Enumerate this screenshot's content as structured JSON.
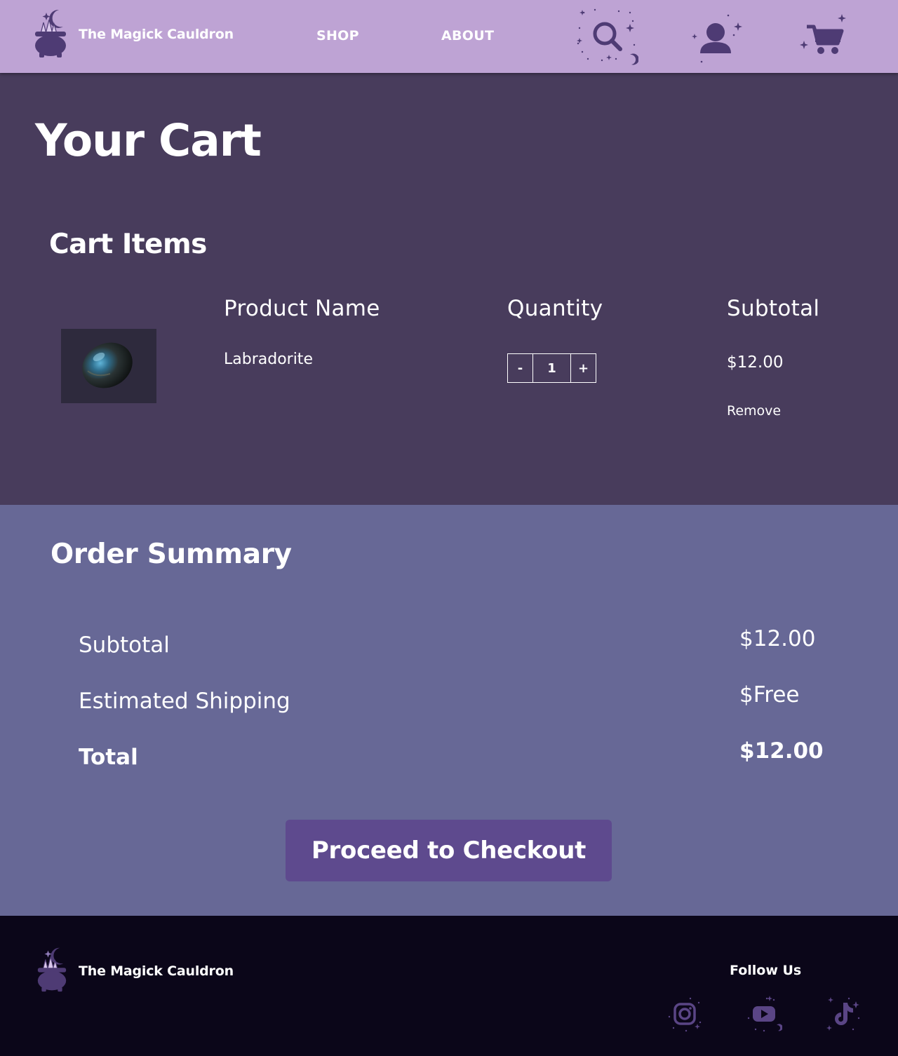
{
  "header": {
    "brand": "The Magick Cauldron",
    "nav": [
      {
        "label": "SHOP"
      },
      {
        "label": "ABOUT"
      }
    ],
    "icons": [
      "search-icon",
      "account-icon",
      "cart-icon"
    ]
  },
  "page": {
    "title": "Your Cart"
  },
  "cart": {
    "section_title": "Cart Items",
    "columns": {
      "product": "Product Name",
      "quantity": "Quantity",
      "subtotal": "Subtotal"
    },
    "items": [
      {
        "name": "Labradorite",
        "quantity": "1",
        "minus": "-",
        "plus": "+",
        "subtotal": "$12.00",
        "remove": "Remove"
      }
    ]
  },
  "summary": {
    "title": "Order Summary",
    "rows": [
      {
        "label": "Subtotal",
        "value": "$12.00"
      },
      {
        "label": "Estimated Shipping",
        "value": "$Free"
      },
      {
        "label": "Total",
        "value": "$12.00"
      }
    ],
    "checkout": "Proceed to Checkout"
  },
  "footer": {
    "brand": "The Magick Cauldron",
    "follow": "Follow Us",
    "social": [
      "instagram-icon",
      "youtube-icon",
      "tiktok-icon"
    ]
  },
  "colors": {
    "header": "#bea3d4",
    "cart_bg": "#483c5c",
    "summary_bg": "#676896",
    "footer_bg": "#0b0619",
    "button": "#5e4a8e",
    "icon_dark": "#4e3b74"
  }
}
